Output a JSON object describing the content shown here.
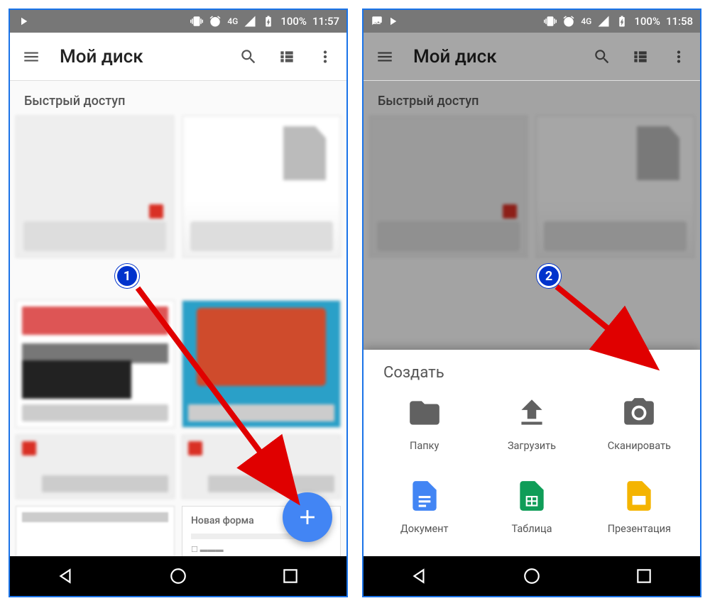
{
  "status": {
    "battery_text": "100%",
    "time_left": "11:57",
    "time_right": "11:58",
    "network": "4G"
  },
  "appbar": {
    "title": "Мой диск"
  },
  "quick": {
    "section_label": "Быстрый доступ"
  },
  "form_card": {
    "title": "Новая форма"
  },
  "sheet": {
    "title": "Создать",
    "items": {
      "folder": "Папку",
      "upload": "Загрузить",
      "scan": "Сканировать",
      "doc": "Документ",
      "table": "Таблица",
      "slides": "Презентация"
    }
  },
  "annotations": {
    "step1": "1",
    "step2": "2"
  }
}
